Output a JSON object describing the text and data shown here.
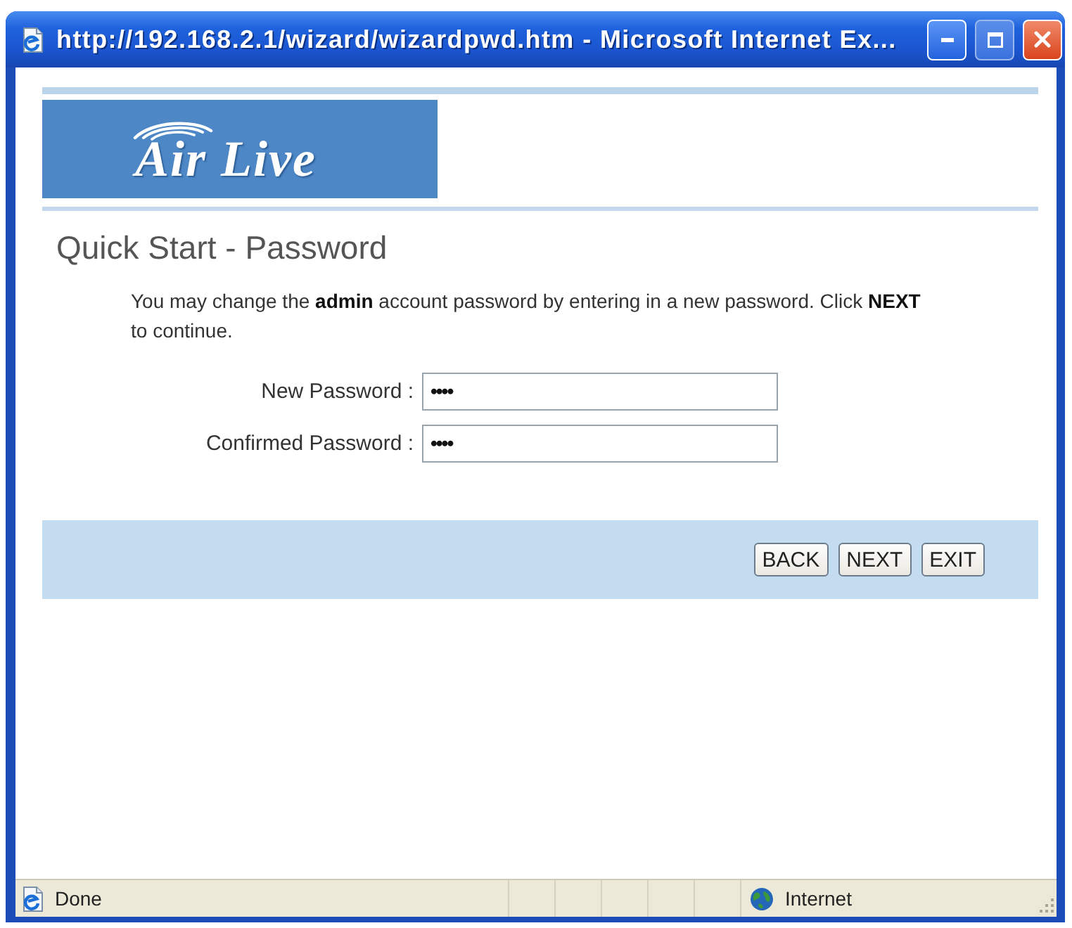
{
  "window": {
    "title": "http://192.168.2.1/wizard/wizardpwd.htm - Microsoft Internet Ex...",
    "controls": [
      {
        "kind": "minimize",
        "disabled": false
      },
      {
        "kind": "maximize",
        "disabled": true
      },
      {
        "kind": "close",
        "disabled": false
      }
    ]
  },
  "logo": {
    "text": "Air Live"
  },
  "heading": "Quick Start - Password",
  "instructions": "You may change the **admin** account password by entering in a new password. Click **NEXT** to continue.",
  "fields": [
    {
      "label": "New Password :",
      "value": "••••"
    },
    {
      "label": "Confirmed Password :",
      "value": "••••"
    }
  ],
  "buttons": [
    "BACK",
    "NEXT",
    "EXIT"
  ],
  "status_bar": {
    "text": "Done",
    "zone": "Internet"
  }
}
